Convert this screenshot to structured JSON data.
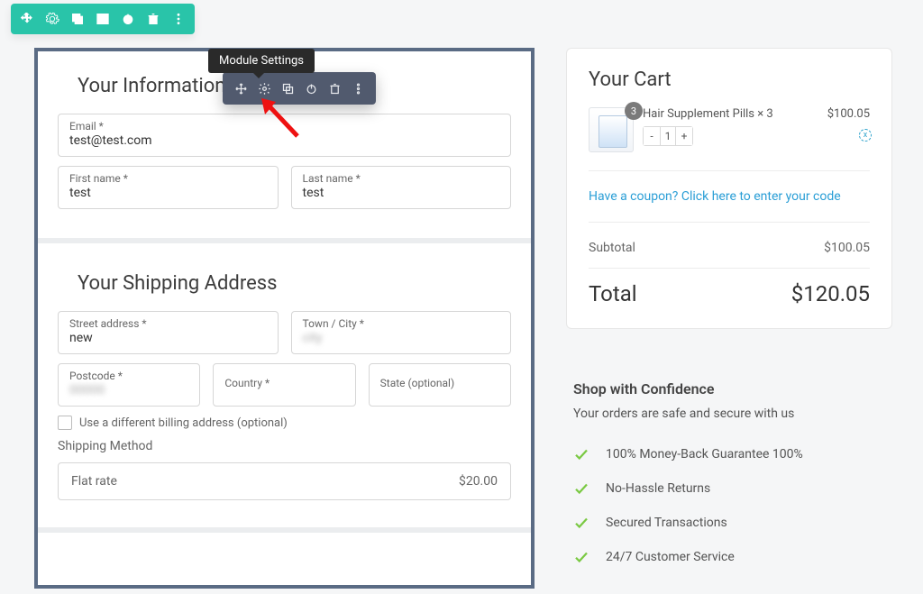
{
  "tooltip": "Module Settings",
  "form": {
    "info_title": "Your Information",
    "email_label": "Email *",
    "email_value": "test@test.com",
    "first_label": "First name *",
    "first_value": "test",
    "last_label": "Last name *",
    "last_value": "test",
    "ship_title": "Your Shipping Address",
    "street_label": "Street address *",
    "street_value": "new",
    "town_label": "Town / City *",
    "town_value": "city",
    "postcode_label": "Postcode *",
    "postcode_value": "00000",
    "country_label": "Country *",
    "state_label": "State (optional)",
    "diff_billing": "Use a different billing address (optional)",
    "ship_method_heading": "Shipping Method",
    "flat_rate_label": "Flat rate",
    "flat_rate_price": "$20.00"
  },
  "cart": {
    "title": "Your Cart",
    "item_name": "Hair Supplement Pills × 3",
    "item_qty_badge": "3",
    "item_qty": "1",
    "item_price": "$100.05",
    "remove": "x",
    "coupon": "Have a coupon? Click here to enter your code",
    "subtotal_label": "Subtotal",
    "subtotal_value": "$100.05",
    "total_label": "Total",
    "total_value": "$120.05"
  },
  "confidence": {
    "title": "Shop with Confidence",
    "subtitle": "Your orders are safe and secure with us",
    "items": [
      "100% Money-Back Guarantee 100%",
      "No-Hassle Returns",
      "Secured Transactions",
      "24/7 Customer Service"
    ]
  }
}
